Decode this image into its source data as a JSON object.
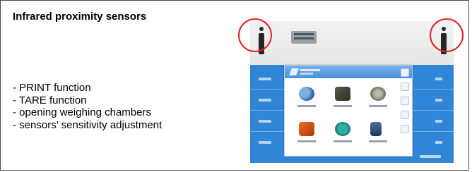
{
  "slide": {
    "title": "Infrared proximity sensors",
    "features": [
      "PRINT function",
      "TARE function",
      "opening weighing chambers",
      "sensors’ sensitivity adjustment"
    ]
  },
  "device_image": {
    "screen_color": "#2f86d6",
    "highlight_color": "#e32020",
    "sensor_icon": "info-i-icon",
    "menu_icons": [
      "weights-icon",
      "device-icon",
      "scale-icon",
      "boxes-icon",
      "globe-icon",
      "chart-icon"
    ]
  }
}
